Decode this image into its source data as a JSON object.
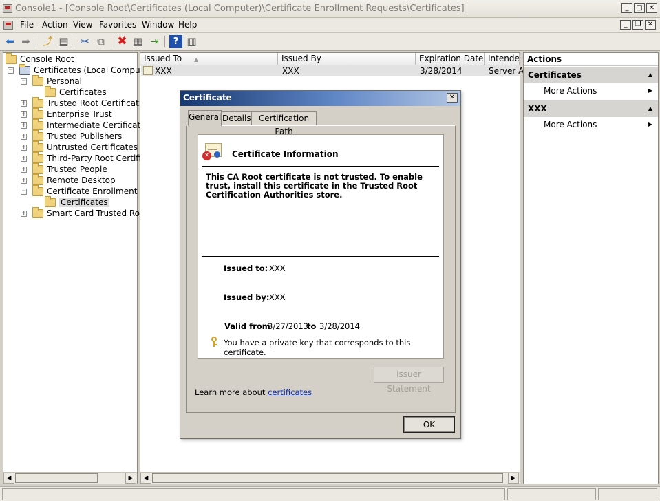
{
  "window": {
    "title": "Console1 - [Console Root\\Certificates (Local Computer)\\Certificate Enrollment Requests\\Certificates]",
    "controls": {
      "minimize": "_",
      "maximize": "□",
      "close": "✕"
    }
  },
  "menubar": {
    "items": [
      "File",
      "Action",
      "View",
      "Favorites",
      "Window",
      "Help"
    ],
    "child_controls": {
      "minimize": "_",
      "restore": "❐",
      "close": "✕"
    }
  },
  "toolbar": {
    "buttons": [
      "back-icon",
      "forward-icon",
      "up-folder-icon",
      "show-hide-tree-icon",
      "cut-icon",
      "copy-icon",
      "delete-icon",
      "properties-icon",
      "export-icon",
      "help-icon",
      "show-action-pane-icon"
    ],
    "glyphs": {
      "back": "⬅",
      "forward": "➡",
      "up": "⤴",
      "tree": "▤",
      "cut": "✂",
      "copy": "⧉",
      "delete": "✖",
      "props": "▦",
      "export": "⇥",
      "help": "?",
      "action_pane": "▥"
    }
  },
  "tree": {
    "items": [
      {
        "label": "Console Root",
        "indent": 0,
        "expander": ""
      },
      {
        "label": "Certificates (Local Computer)",
        "indent": 1,
        "expander": "−"
      },
      {
        "label": "Personal",
        "indent": 2,
        "expander": "−"
      },
      {
        "label": "Certificates",
        "indent": 3,
        "expander": ""
      },
      {
        "label": "Trusted Root Certification A",
        "indent": 2,
        "expander": "+"
      },
      {
        "label": "Enterprise Trust",
        "indent": 2,
        "expander": "+"
      },
      {
        "label": "Intermediate Certification A",
        "indent": 2,
        "expander": "+"
      },
      {
        "label": "Trusted Publishers",
        "indent": 2,
        "expander": "+"
      },
      {
        "label": "Untrusted Certificates",
        "indent": 2,
        "expander": "+"
      },
      {
        "label": "Third-Party Root Certificatio",
        "indent": 2,
        "expander": "+"
      },
      {
        "label": "Trusted People",
        "indent": 2,
        "expander": "+"
      },
      {
        "label": "Remote Desktop",
        "indent": 2,
        "expander": "+"
      },
      {
        "label": "Certificate Enrollment Requ",
        "indent": 2,
        "expander": "−"
      },
      {
        "label": "Certificates",
        "indent": 3,
        "expander": "",
        "selected": true
      },
      {
        "label": "Smart Card Trusted Roots",
        "indent": 2,
        "expander": "+"
      }
    ]
  },
  "list": {
    "columns": [
      "Issued To",
      "Issued By",
      "Expiration Date",
      "Intended"
    ],
    "sort_indicator": "▲",
    "rows": [
      {
        "issued_to": "XXX",
        "issued_by": "XXX",
        "expiration": "3/28/2014",
        "intended": "Server Au"
      }
    ]
  },
  "actions": {
    "title": "Actions",
    "sections": [
      {
        "header": "Certificates",
        "item": "More Actions"
      },
      {
        "header": "XXX",
        "item": "More Actions"
      }
    ],
    "collapse_glyph": "▲",
    "more_glyph": "▶"
  },
  "dialog": {
    "title": "Certificate",
    "close": "✕",
    "tabs": [
      "General",
      "Details",
      "Certification Path"
    ],
    "info_heading": "Certificate Information",
    "warning_text": "This CA Root certificate is not trusted. To enable trust, install this certificate in the Trusted Root Certification Authorities store.",
    "issued_to_label": "Issued to:",
    "issued_to_value": "XXX",
    "issued_by_label": "Issued by:",
    "issued_by_value": "XXX",
    "valid_from_label": "Valid from",
    "valid_from": "3/27/2013",
    "valid_to_label": "to",
    "valid_to": "3/28/2014",
    "private_key_text": "You have a private key that corresponds to this certificate.",
    "issuer_statement_label": "Issuer Statement",
    "learn_more_prefix": "Learn more about ",
    "learn_more_link": "certificates",
    "ok_label": "OK"
  },
  "scroll": {
    "left": "◀",
    "right": "▶"
  }
}
